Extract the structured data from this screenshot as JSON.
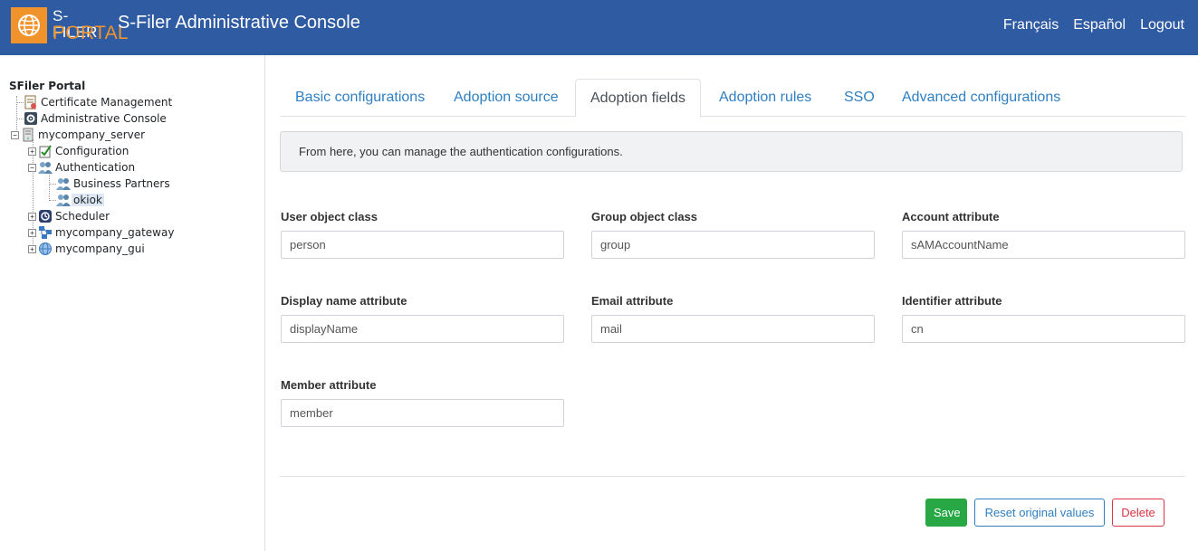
{
  "header": {
    "logo_line1": "S-FILER",
    "logo_line2": "PORTAL",
    "title": "S-Filer Administrative Console",
    "links": [
      "Français",
      "Español",
      "Logout"
    ]
  },
  "tree": {
    "root": "SFiler Portal",
    "nodes": [
      {
        "label": "Certificate Management",
        "icon": "certificate-icon"
      },
      {
        "label": "Administrative Console",
        "icon": "admin-console-icon"
      },
      {
        "label": "mycompany_server",
        "icon": "server-icon",
        "expander": "−"
      },
      {
        "label": "Configuration",
        "icon": "configuration-icon",
        "expander": "+"
      },
      {
        "label": "Authentication",
        "icon": "users-icon",
        "expander": "−"
      },
      {
        "label": "Business Partners",
        "icon": "users-icon"
      },
      {
        "label": "okiok",
        "icon": "users-icon",
        "selected": true
      },
      {
        "label": "Scheduler",
        "icon": "scheduler-icon",
        "expander": "+"
      },
      {
        "label": "mycompany_gateway",
        "icon": "gateway-icon",
        "expander": "+"
      },
      {
        "label": "mycompany_gui",
        "icon": "globe-icon",
        "expander": "+"
      }
    ]
  },
  "tabs": [
    {
      "label": "Basic configurations",
      "active": false
    },
    {
      "label": "Adoption source",
      "active": false
    },
    {
      "label": "Adoption fields",
      "active": true
    },
    {
      "label": "Adoption rules",
      "active": false
    },
    {
      "label": "SSO",
      "active": false
    },
    {
      "label": "Advanced configurations",
      "active": false
    }
  ],
  "info_text": "From here, you can manage the authentication configurations.",
  "fields": {
    "user_object_class": {
      "label": "User object class",
      "value": "person"
    },
    "group_object_class": {
      "label": "Group object class",
      "value": "group"
    },
    "account_attribute": {
      "label": "Account attribute",
      "value": "sAMAccountName"
    },
    "display_name_attribute": {
      "label": "Display name attribute",
      "value": "displayName"
    },
    "email_attribute": {
      "label": "Email attribute",
      "value": "mail"
    },
    "identifier_attribute": {
      "label": "Identifier attribute",
      "value": "cn"
    },
    "member_attribute": {
      "label": "Member attribute",
      "value": "member"
    }
  },
  "buttons": {
    "save": "Save",
    "reset": "Reset original values",
    "delete": "Delete"
  },
  "colors": {
    "header_bg": "#2f5ba2",
    "brand_orange": "#f0932b",
    "link_blue": "#2f7fc1",
    "save_green": "#28a745",
    "delete_red": "#dc3545"
  }
}
